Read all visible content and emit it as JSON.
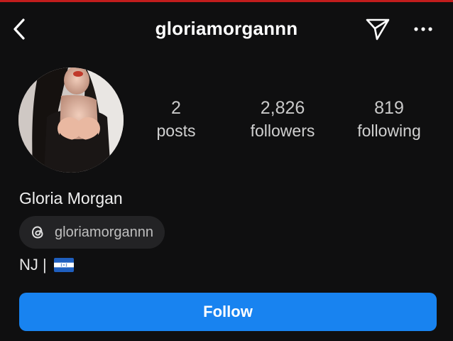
{
  "profile": {
    "username": "gloriamorgannn",
    "display_name": "Gloria Morgan",
    "bio_text": "NJ |",
    "threads_handle": "gloriamorgannn"
  },
  "stats": {
    "posts": {
      "count": "2",
      "label": "posts"
    },
    "followers": {
      "count": "2,826",
      "label": "followers"
    },
    "following": {
      "count": "819",
      "label": "following"
    }
  },
  "actions": {
    "follow_label": "Follow"
  },
  "icons": {
    "back": "chevron-left-icon",
    "send": "paper-plane-icon",
    "more": "more-horizontal-icon",
    "threads": "threads-icon",
    "flag": "honduras-flag-icon"
  },
  "colors": {
    "background": "#0f0f10",
    "accent": "#1883f0",
    "pill": "#232325",
    "top_line": "#c21d1d"
  }
}
